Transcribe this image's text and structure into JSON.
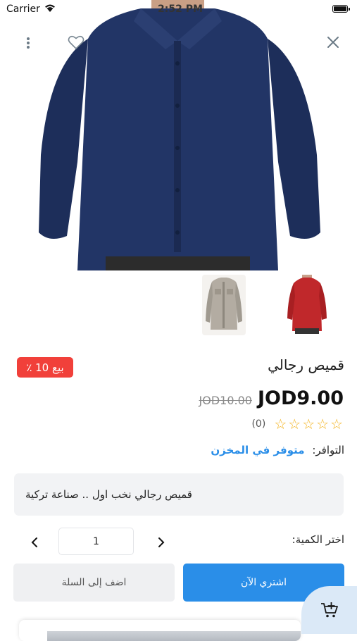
{
  "status_bar": {
    "carrier": "Carrier",
    "time": "2:52 PM"
  },
  "product": {
    "title": "قميص رجالي",
    "sale_badge": "بيع 10 ٪",
    "price": "JOD9.00",
    "old_price": "JOD10.00",
    "rating_stars": 0,
    "rating_count": "(0)",
    "availability_label": "التوافر:",
    "availability_value": "متوفر في المخزن",
    "description": "قميص رجالي نخب اول .. صناعة تركية",
    "quantity_label": "اختر الكمية:",
    "quantity": "1"
  },
  "buttons": {
    "buy_now": "اشتري الآن",
    "add_to_cart": "اضف إلى السلة"
  },
  "colors": {
    "accent": "#2a8ee8",
    "badge": "#f1403a",
    "star": "#f3b21b",
    "shirt_main": "#223566",
    "shirt_red": "#c0282b",
    "shirt_beige": "#b3aca2"
  },
  "icons": [
    "more-vertical-icon",
    "heart-icon",
    "close-icon",
    "chevron-left-icon",
    "chevron-right-icon",
    "add-to-cart-icon",
    "star-outline-icon"
  ]
}
